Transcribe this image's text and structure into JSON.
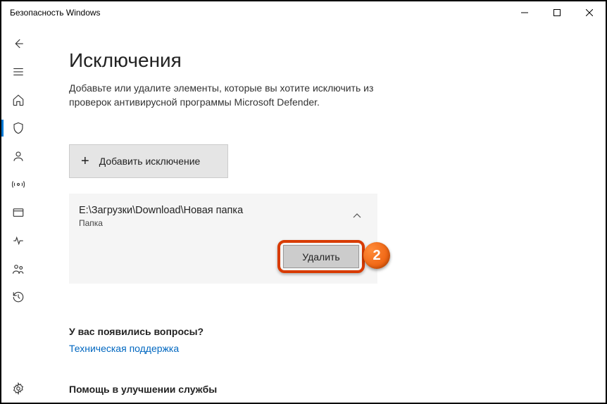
{
  "window": {
    "title": "Безопасность Windows"
  },
  "page": {
    "heading": "Исключения",
    "description": "Добавьте или удалите элементы, которые вы хотите исключить из проверок антивирусной программы Microsoft Defender."
  },
  "add_button": {
    "label": "Добавить исключение"
  },
  "exclusion": {
    "path": "E:\\Загрузки\\Download\\Новая папка",
    "type": "Папка",
    "delete_label": "Удалить"
  },
  "questions": {
    "title": "У вас появились вопросы?",
    "link": "Техническая поддержка"
  },
  "help": {
    "title": "Помощь в улучшении службы"
  },
  "annotation": {
    "badge": "2"
  }
}
